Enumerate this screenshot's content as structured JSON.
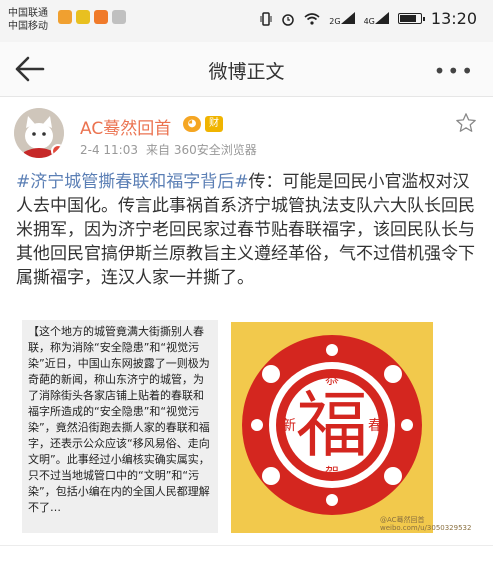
{
  "status_bar": {
    "carrier1": "中国联通",
    "carrier2": "中国移动",
    "network1": "2G",
    "network2": "4G",
    "time": "13:20",
    "battery_level": 0.85
  },
  "nav": {
    "title": "微博正文"
  },
  "post": {
    "username": "AC蓦然回首",
    "badge": "财",
    "date": "2-4 11:03",
    "source": "来自 360安全浏览器",
    "hashtag": "#济宁城管撕春联和福字背后#",
    "body": "传：可能是回民小官滥权对汉人去中国化。传言此事祸首系济宁城管执法支队六大队长回民米拥军，因为济宁老回民家过春节贴春联福字，该回民队长与其他回民官搞伊斯兰原教旨主义遵经革俗，气不过借机强令下属撕福字，连汉人家一并撕了。",
    "image_text": "【这个地方的城管竟满大街撕别人春联，称为消除“安全隐患”和“视觉污染”近日，中国山东网披露了一则极为奇葩的新闻，称山东济宁的城管，为了消除街头各家店铺上贴着的春联和福字所造成的“安全隐患”和“视觉污染”，竟然沿街跑去撕人家的春联和福字，还表示公众应该“移风易俗、走向文明”。此事经过小编核实确实属实，只不过当地城管口中的“文明”和“污染”，包括小编在内的全国人民都理解不了…",
    "fu_image": {
      "center": "福",
      "ring_chars": [
        "恭",
        "新",
        "春",
        "贺"
      ],
      "background_color": "#f2c94c",
      "red_color": "#d4261f"
    },
    "watermark": "@AC蓦然回首 weibo.com/u/3050329532"
  },
  "colors": {
    "username": "#eb7350",
    "hashtag": "#5b7fb5"
  }
}
